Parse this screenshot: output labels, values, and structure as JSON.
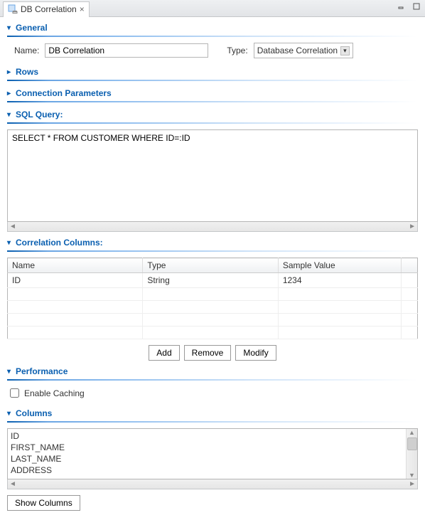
{
  "tab": {
    "title": "DB Correlation"
  },
  "sections": {
    "general": "General",
    "rows": "Rows",
    "connection": "Connection Parameters",
    "sql": "SQL Query:",
    "corrcols": "Correlation Columns:",
    "performance": "Performance",
    "columns": "Columns"
  },
  "general": {
    "name_label": "Name:",
    "name_value": "DB Correlation",
    "type_label": "Type:",
    "type_value": "Database Correlation"
  },
  "sql": {
    "query": "SELECT * FROM CUSTOMER WHERE ID=:ID"
  },
  "corrcols": {
    "headers": {
      "name": "Name",
      "type": "Type",
      "sample": "Sample Value"
    },
    "rows": [
      {
        "name": "ID",
        "type": "String",
        "sample": "1234"
      }
    ],
    "buttons": {
      "add": "Add",
      "remove": "Remove",
      "modify": "Modify"
    }
  },
  "performance": {
    "enable_caching_label": "Enable Caching",
    "enable_caching_checked": false
  },
  "columns": {
    "items": [
      "ID",
      "FIRST_NAME",
      "LAST_NAME",
      "ADDRESS"
    ],
    "show_button": "Show Columns"
  }
}
